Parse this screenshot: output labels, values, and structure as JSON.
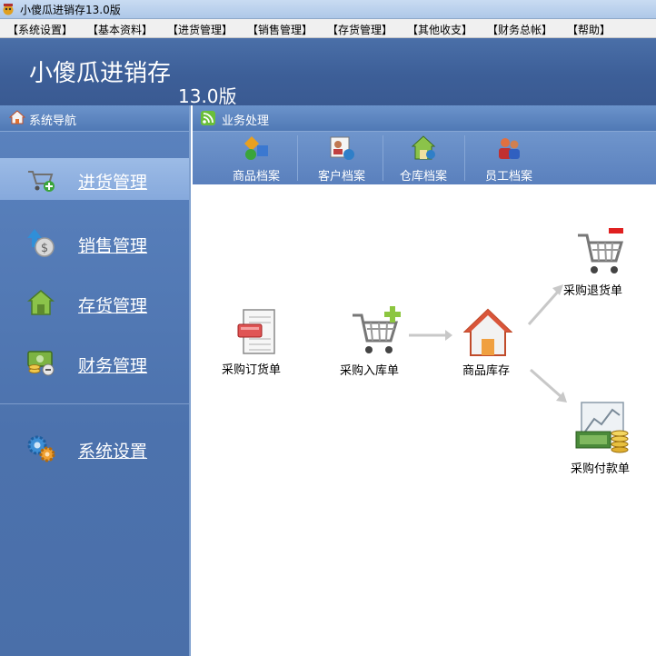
{
  "window": {
    "title": "小傻瓜进销存13.0版"
  },
  "menu": [
    "【系统设置】",
    "【基本资料】",
    "【进货管理】",
    "【销售管理】",
    "【存货管理】",
    "【其他收支】",
    "【财务总帐】",
    "【帮助】"
  ],
  "header": {
    "app_name": "小傻瓜进销存",
    "version": "13.0版"
  },
  "sidebar": {
    "title": "系统导航",
    "items": [
      {
        "label": "进货管理",
        "icon": "cart-add-icon",
        "active": true
      },
      {
        "label": "销售管理",
        "icon": "money-up-icon"
      },
      {
        "label": "存货管理",
        "icon": "warehouse-icon"
      },
      {
        "label": "财务管理",
        "icon": "finance-icon"
      },
      {
        "label": "系统设置",
        "icon": "gears-icon"
      }
    ]
  },
  "main": {
    "title": "业务处理",
    "toolbar": [
      {
        "label": "商品档案",
        "icon": "goods-icon"
      },
      {
        "label": "客户档案",
        "icon": "customer-icon"
      },
      {
        "label": "仓库档案",
        "icon": "warehouse-icon"
      },
      {
        "label": "员工档案",
        "icon": "staff-icon"
      }
    ],
    "flow": {
      "purchase_order": "采购订货单",
      "purchase_inbound": "采购入库单",
      "goods_stock": "商品库存",
      "purchase_return": "采购退货单",
      "purchase_payment": "采购付款单"
    }
  },
  "colors": {
    "header_blue": "#3d5f98",
    "sidebar_blue": "#4c72ad",
    "active_item": "#9cbbe6",
    "toolbar_blue": "#6f95cc",
    "arrow_gray": "#c8c8c8"
  }
}
